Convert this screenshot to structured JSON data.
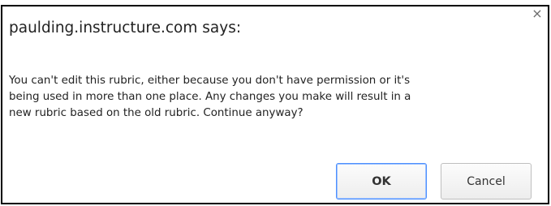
{
  "dialog": {
    "title": "paulding.instructure.com says:",
    "message": "You can't edit this rubric, either because you don't have permission or it's\nbeing used in more than one place. Any changes you make will result in a\nnew rubric based on the old rubric. Continue anyway?",
    "close_icon": "close-icon",
    "close_glyph": "×",
    "buttons": {
      "ok_label": "OK",
      "cancel_label": "Cancel"
    }
  },
  "colors": {
    "focus_ring": "#4d90fe",
    "text": "#222222"
  }
}
